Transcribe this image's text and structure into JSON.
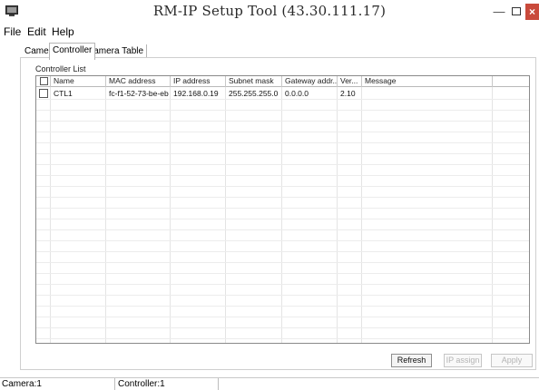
{
  "window": {
    "title": "RM-IP Setup Tool (43.30.111.17)"
  },
  "menu": [
    {
      "label": "File"
    },
    {
      "label": "Edit"
    },
    {
      "label": "Help"
    }
  ],
  "tabs": [
    {
      "label": "Camera"
    },
    {
      "label": "Controller",
      "selected": true
    },
    {
      "label": "Camera Table"
    }
  ],
  "controller_list": {
    "label": "Controller List",
    "columns": [
      "Name",
      "MAC address",
      "IP address",
      "Subnet mask",
      "Gateway addr...",
      "Ver...",
      "Message"
    ],
    "rows": [
      {
        "name": "CTL1",
        "mac": "fc-f1-52-73-be-eb",
        "ip": "192.168.0.19",
        "subnet": "255.255.255.0",
        "gateway": "0.0.0.0",
        "version": "2.10",
        "message": ""
      }
    ]
  },
  "buttons": {
    "refresh": "Refresh",
    "ip_assign": "IP assign",
    "apply": "Apply"
  },
  "status": {
    "camera": "Camera:1",
    "controller": "Controller:1"
  }
}
